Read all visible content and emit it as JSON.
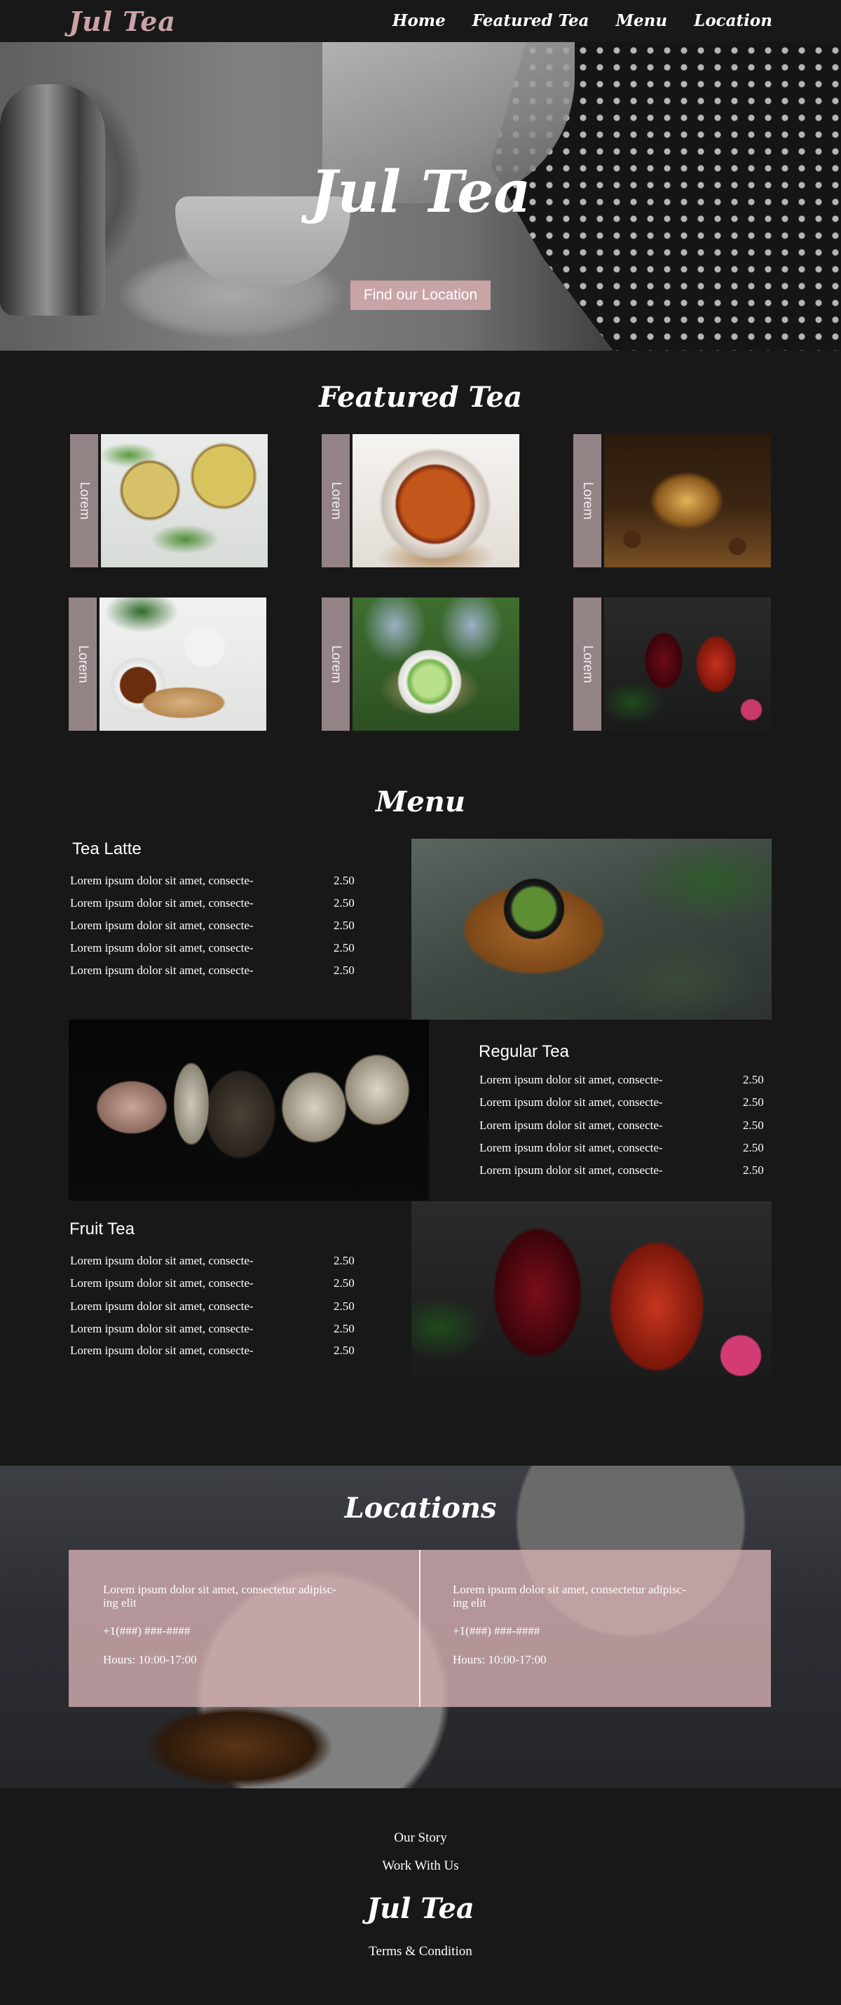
{
  "nav": {
    "logo": "Jul Tea",
    "links": [
      "Home",
      "Featured Tea",
      "Menu",
      "Location"
    ]
  },
  "hero": {
    "title": "Jul Tea",
    "button": "Find our Location"
  },
  "featured": {
    "title": "Featured Tea",
    "cards": [
      {
        "label": "Lorem"
      },
      {
        "label": "Lorem"
      },
      {
        "label": "Lorem"
      },
      {
        "label": "Lorem"
      },
      {
        "label": "Lorem"
      },
      {
        "label": "Lorem"
      }
    ]
  },
  "menu": {
    "title": "Menu",
    "sections": [
      {
        "name": "Tea Latte",
        "items": [
          {
            "name": "Lorem ipsum dolor sit amet, consecte-",
            "price": "2.50"
          },
          {
            "name": "Lorem ipsum dolor sit amet, consecte-",
            "price": "2.50"
          },
          {
            "name": "Lorem ipsum dolor sit amet, consecte-",
            "price": "2.50"
          },
          {
            "name": "Lorem ipsum dolor sit amet, consecte-",
            "price": "2.50"
          },
          {
            "name": "Lorem ipsum dolor sit amet, consecte-",
            "price": "2.50"
          }
        ]
      },
      {
        "name": "Regular Tea",
        "items": [
          {
            "name": "Lorem ipsum dolor sit amet, consecte-",
            "price": "2.50"
          },
          {
            "name": "Lorem ipsum dolor sit amet, consecte-",
            "price": "2.50"
          },
          {
            "name": "Lorem ipsum dolor sit amet, consecte-",
            "price": "2.50"
          },
          {
            "name": "Lorem ipsum dolor sit amet, consecte-",
            "price": "2.50"
          },
          {
            "name": "Lorem ipsum dolor sit amet, consecte-",
            "price": "2.50"
          }
        ]
      },
      {
        "name": "Fruit Tea",
        "items": [
          {
            "name": "Lorem ipsum dolor sit amet, consecte-",
            "price": "2.50"
          },
          {
            "name": "Lorem ipsum dolor sit amet, consecte-",
            "price": "2.50"
          },
          {
            "name": "Lorem ipsum dolor sit amet, consecte-",
            "price": "2.50"
          },
          {
            "name": "Lorem ipsum dolor sit amet, consecte-",
            "price": "2.50"
          },
          {
            "name": "Lorem ipsum dolor sit amet, consecte-",
            "price": "2.50"
          }
        ]
      }
    ]
  },
  "locations": {
    "title": "Locations",
    "items": [
      {
        "address_1": "Lorem ipsum dolor sit amet, consectetur adipisc-",
        "address_2": "ing elit",
        "phone": "+1(###) ###-####",
        "hours": "Hours: 10:00-17:00"
      },
      {
        "address_1": "Lorem ipsum dolor sit amet, consectetur adipisc-",
        "address_2": "ing elit",
        "phone": "+1(###) ###-####",
        "hours": "Hours: 10:00-17:00"
      }
    ]
  },
  "footer": {
    "our_story": "Our Story",
    "work_with_us": "Work With Us",
    "logo": "Jul Tea",
    "terms": "Terms & Condition"
  },
  "colors": {
    "background": "#181818",
    "accent": "#caa3a8",
    "label_bar": "#948385",
    "button": "#c9a4a6"
  }
}
